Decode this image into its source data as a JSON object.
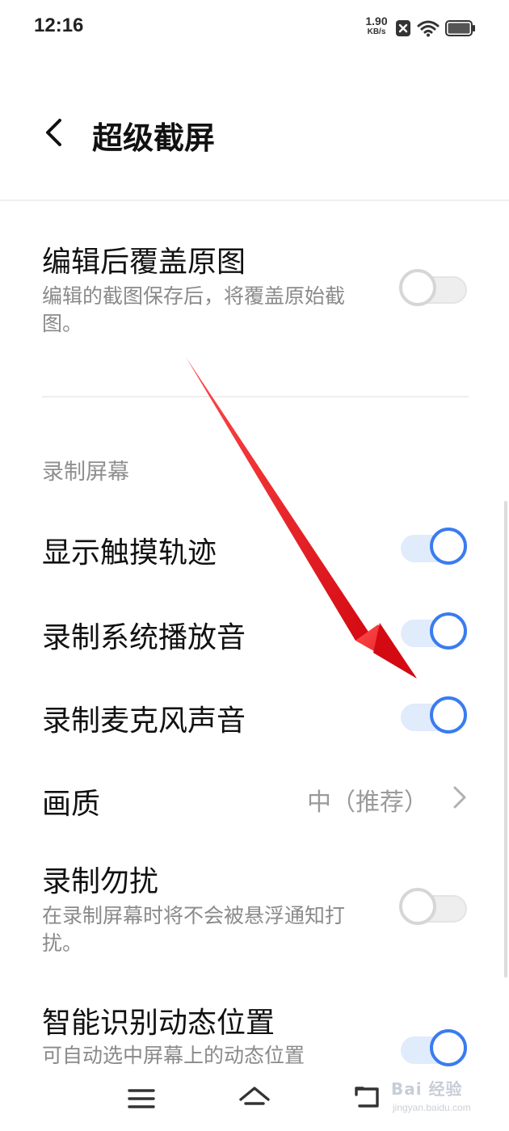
{
  "status_bar": {
    "time": "12:16",
    "net_speed_value": "1.90",
    "net_speed_unit": "KB/s",
    "icons": [
      "sim-x-icon",
      "wifi-icon",
      "battery-icon"
    ]
  },
  "header": {
    "back_icon": "chevron-left-icon",
    "title": "超级截屏"
  },
  "screenshot_settings": {
    "overwrite_original": {
      "title": "编辑后覆盖原图",
      "description": "编辑的截图保存后，将覆盖原始截图。",
      "enabled": false
    }
  },
  "screen_recording": {
    "section_label": "录制屏幕",
    "show_touch": {
      "title": "显示触摸轨迹",
      "enabled": true
    },
    "record_system_audio": {
      "title": "录制系统播放音",
      "enabled": true
    },
    "record_microphone": {
      "title": "录制麦克风声音",
      "enabled": true
    },
    "quality": {
      "title": "画质",
      "value": "中（推荐）"
    },
    "do_not_disturb": {
      "title": "录制勿扰",
      "description": "在录制屏幕时将不会被悬浮通知打扰。",
      "enabled": false
    },
    "smart_dynamic_position": {
      "title": "智能识别动态位置",
      "description": "可自动选中屏幕上的动态位置",
      "enabled": true
    }
  },
  "nav_bar": {
    "icons": [
      "menu-icon",
      "home-icon",
      "back-icon"
    ]
  },
  "annotation": {
    "arrow_color": "#e8141c"
  },
  "watermark": {
    "text": "Bai 经验",
    "sub": "jingyan.baidu.com"
  },
  "colors": {
    "accent": "#3a7bf0",
    "toggle_on_track": "#e0ebfb",
    "toggle_off_track": "#eeeeee"
  }
}
